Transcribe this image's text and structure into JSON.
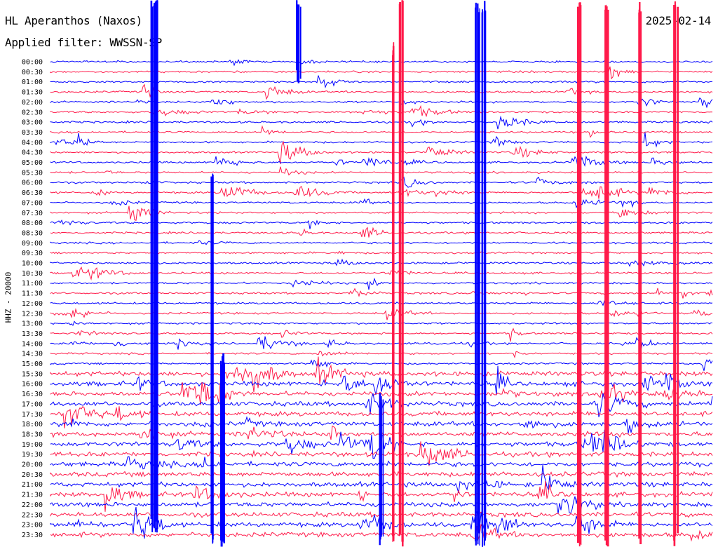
{
  "header": {
    "station": "HL Aperanthos (Naxos)",
    "date": "2025-02-14",
    "filter": "Applied filter: WWSSN-SP"
  },
  "channel_label": "HHZ - 20000",
  "chart_data": {
    "type": "line",
    "title": "HL Aperanthos (Naxos)",
    "subtitle": "Applied filter: WWSSN-SP",
    "ylabel": "HHZ - 20000",
    "row_labels": [
      "00:00",
      "00:30",
      "01:00",
      "01:30",
      "02:00",
      "02:30",
      "03:00",
      "03:30",
      "04:00",
      "04:30",
      "05:00",
      "05:30",
      "06:00",
      "06:30",
      "07:00",
      "07:30",
      "08:00",
      "08:30",
      "09:00",
      "09:30",
      "10:00",
      "10:30",
      "11:00",
      "11:30",
      "12:00",
      "12:30",
      "13:00",
      "13:30",
      "14:00",
      "14:30",
      "15:00",
      "15:30",
      "16:00",
      "16:30",
      "17:00",
      "17:30",
      "18:00",
      "18:30",
      "19:00",
      "19:30",
      "20:00",
      "20:30",
      "21:00",
      "21:30",
      "22:00",
      "22:30",
      "23:00",
      "23:30"
    ],
    "series": [
      {
        "color": "#0000ff"
      },
      {
        "color": "#ff1a4a"
      }
    ],
    "colors": {
      "blue": "#0000ff",
      "red": "#ff1a4a"
    },
    "grid": false
  }
}
